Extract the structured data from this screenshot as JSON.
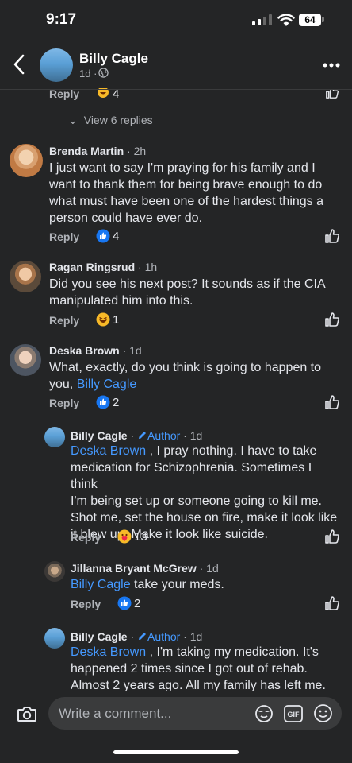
{
  "status": {
    "time": "9:17",
    "battery": "64"
  },
  "header": {
    "name": "Billy Cagle",
    "age": "1d ·"
  },
  "top_partial": {
    "reply_label": "Reply",
    "reaction_count": "4"
  },
  "view_replies": "View 6 replies",
  "comments": [
    {
      "name": "Brenda Martin",
      "meta": " · 2h",
      "lines": [
        "I just want to say I'm praying for his family and I",
        "want to thank them for being brave enough to do",
        "what must have been one of the hardest things a",
        "person could have ever do."
      ],
      "reply": "Reply",
      "reactions": "4",
      "reaction": "like"
    },
    {
      "name": "Ragan Ringsrud",
      "meta": " · 1h",
      "lines": [
        "Did you see his next post?  It sounds as if the CIA",
        "manipulated him into this."
      ],
      "reply": "Reply",
      "reactions": "1",
      "reaction": "haha"
    },
    {
      "name": "Deska Brown",
      "meta": " · 1d",
      "lines": [
        "What, exactly, do you think is going to happen to"
      ],
      "line2_prefix": "you, ",
      "mention": "Billy Cagle",
      "reply": "Reply",
      "reactions": "2",
      "reaction": "like"
    },
    {
      "name": "Billy Cagle",
      "author": "Author",
      "meta": " · 1d",
      "mention": "Deska Brown",
      "first_rest": " , I pray nothing. I have to take",
      "lines": [
        "medication for Schizophrenia. Sometimes I think",
        "I'm being set up or  someone going to kill me.",
        "Shot me, set the house on fire, make it look like",
        "it blew up. Make it look like suicide."
      ],
      "reply": "Reply",
      "reactions": "13",
      "reaction": "care"
    },
    {
      "name": "Jillanna Bryant McGrew",
      "meta": " · 1d",
      "mention": "Billy Cagle",
      "first_rest": " take your meds.",
      "reply": "Reply",
      "reactions": "2",
      "reaction": "like"
    },
    {
      "name": "Billy Cagle",
      "author": "Author",
      "meta": " · 1d",
      "mention": "Deska Brown",
      "first_rest": " , I'm taking my medication. It's",
      "lines": [
        "happened 2 times since I got out of rehab.",
        "Almost 2 years ago. All my family has left me."
      ]
    }
  ],
  "composer": {
    "placeholder": "Write a comment..."
  },
  "icons": {
    "back": "chevron-left-icon",
    "globe": "globe-icon",
    "more": "more-dots-icon",
    "like": "thumbs-up-icon",
    "camera": "camera-icon",
    "sticker": "sticker-icon",
    "gif": "gif-icon",
    "emoji": "emoji-icon"
  },
  "colors": {
    "background": "#242526",
    "accent": "#4599ff",
    "secondary_text": "#b0b3b8",
    "like_blue": "#1877f2"
  }
}
